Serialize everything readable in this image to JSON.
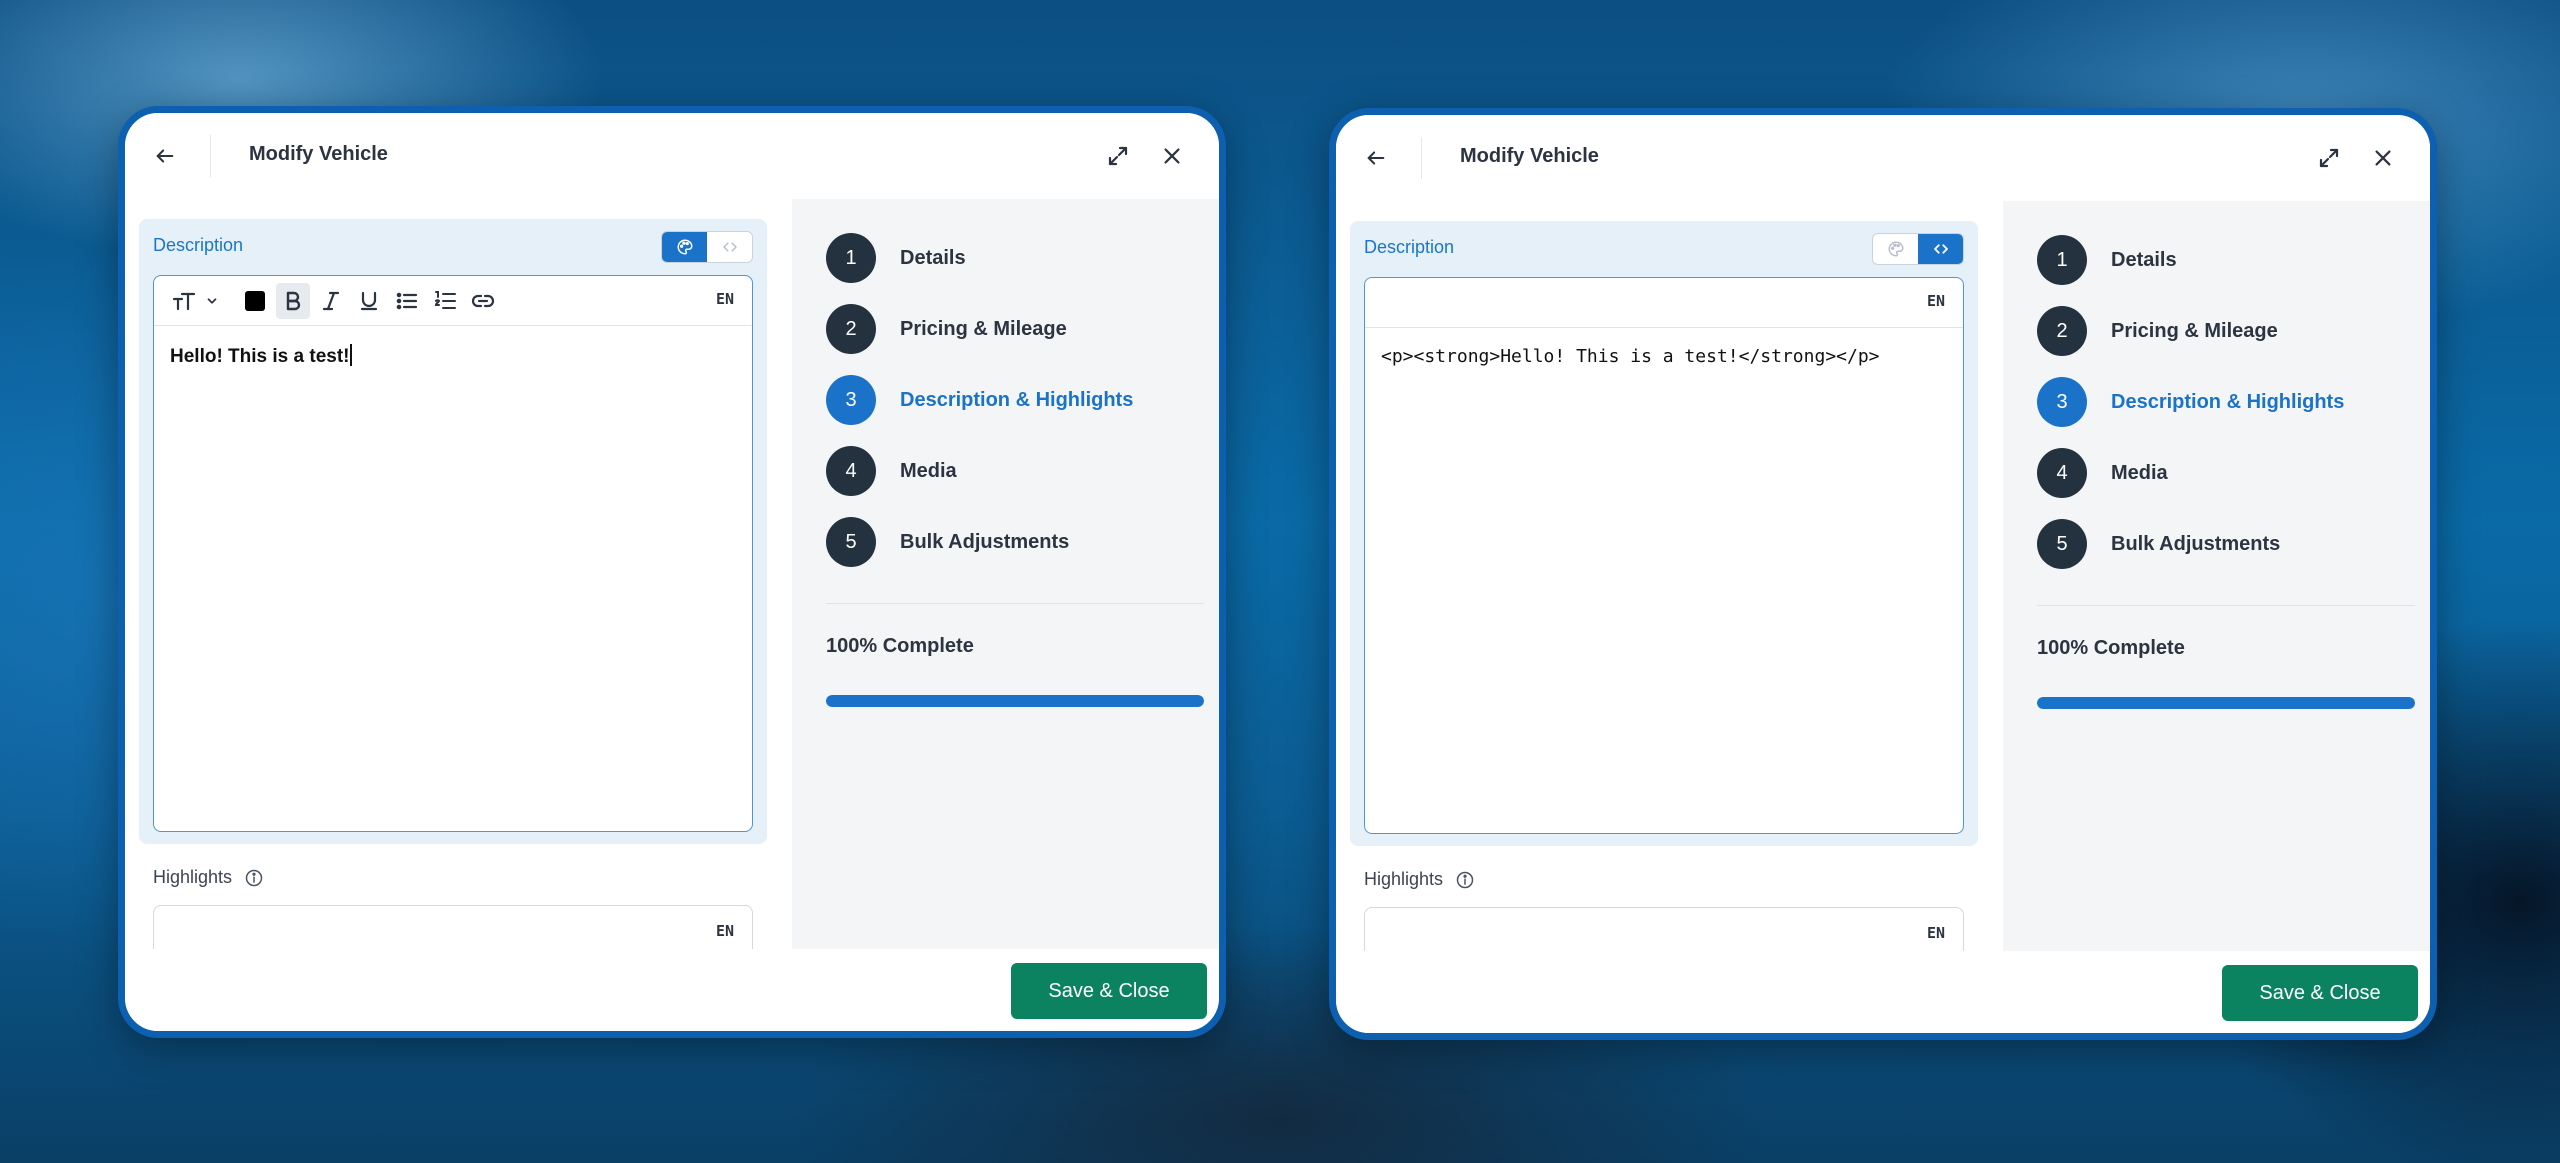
{
  "colors": {
    "accent": "#1a73c9",
    "dark": "#243240",
    "save": "#0b8260",
    "border_blue": "#0d5fb0"
  },
  "windows": [
    {
      "mode": "rich",
      "header": {
        "title": "Modify Vehicle"
      },
      "description": {
        "label": "Description",
        "lang": "EN",
        "content": "Hello! This is a test!"
      },
      "highlights": {
        "label": "Highlights",
        "lang": "EN"
      },
      "steps": [
        {
          "num": "1",
          "label": "Details",
          "active": false
        },
        {
          "num": "2",
          "label": "Pricing & Mileage",
          "active": false
        },
        {
          "num": "3",
          "label": "Description & Highlights",
          "active": true
        },
        {
          "num": "4",
          "label": "Media",
          "active": false
        },
        {
          "num": "5",
          "label": "Bulk Adjustments",
          "active": false
        }
      ],
      "progress": {
        "label": "100% Complete",
        "value": 100
      },
      "footer": {
        "save_label": "Save & Close"
      }
    },
    {
      "mode": "code",
      "header": {
        "title": "Modify Vehicle"
      },
      "description": {
        "label": "Description",
        "lang": "EN",
        "content": "<p><strong>Hello! This is a test!</strong></p>"
      },
      "highlights": {
        "label": "Highlights",
        "lang": "EN"
      },
      "steps": [
        {
          "num": "1",
          "label": "Details",
          "active": false
        },
        {
          "num": "2",
          "label": "Pricing & Mileage",
          "active": false
        },
        {
          "num": "3",
          "label": "Description & Highlights",
          "active": true
        },
        {
          "num": "4",
          "label": "Media",
          "active": false
        },
        {
          "num": "5",
          "label": "Bulk Adjustments",
          "active": false
        }
      ],
      "progress": {
        "label": "100% Complete",
        "value": 100
      },
      "footer": {
        "save_label": "Save & Close"
      }
    }
  ]
}
